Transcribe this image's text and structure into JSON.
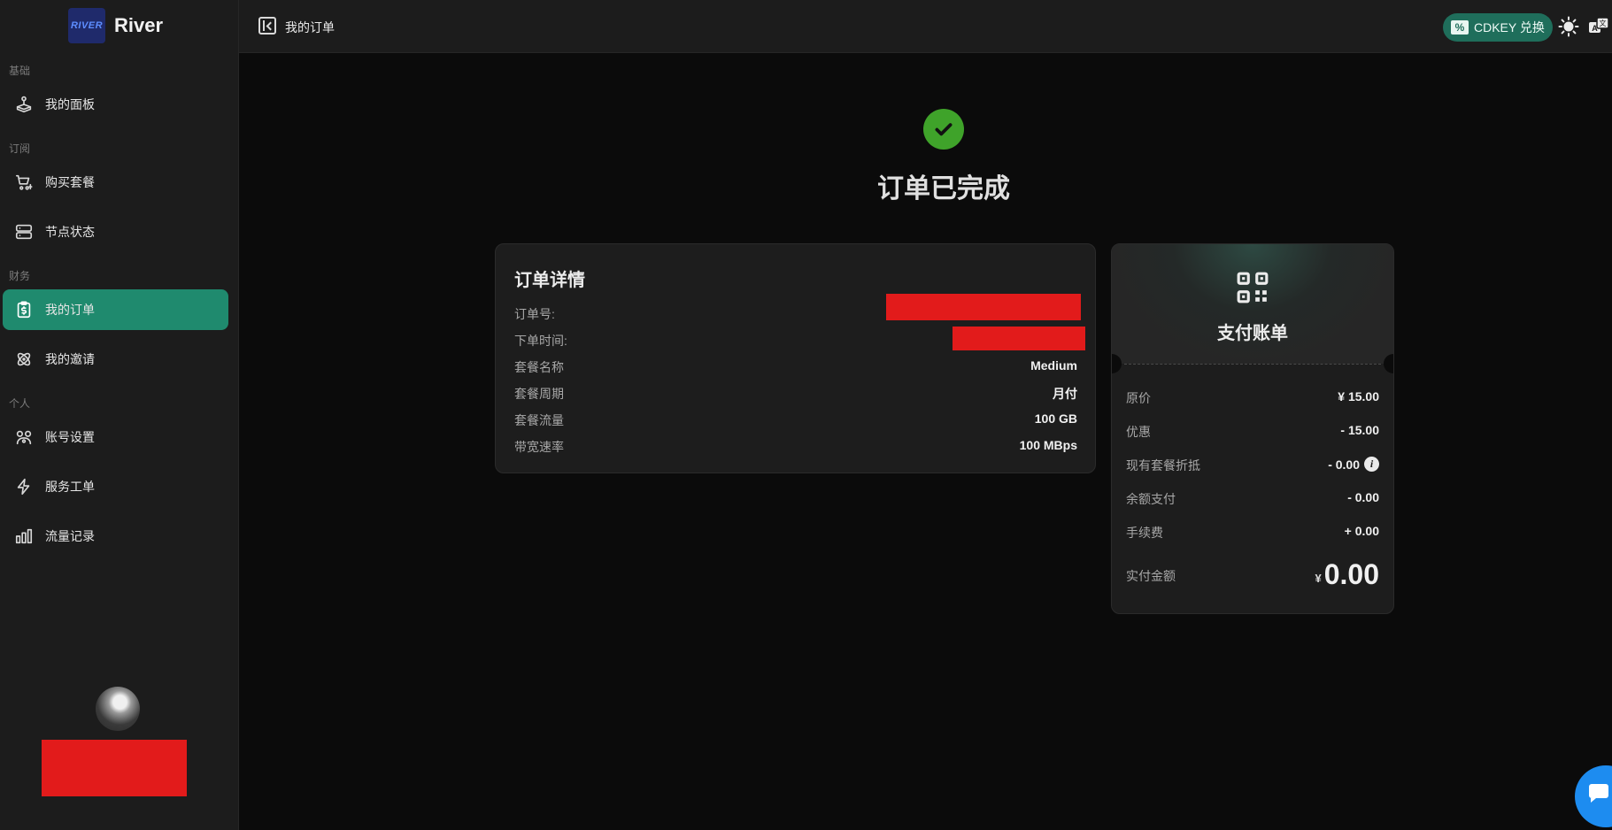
{
  "brand": {
    "logo_text": "RIVER",
    "name": "River"
  },
  "sidebar": {
    "sections": [
      {
        "label": "基础",
        "items": [
          {
            "label": "我的面板",
            "icon": "dashboard-icon"
          }
        ]
      },
      {
        "label": "订阅",
        "items": [
          {
            "label": "购买套餐",
            "icon": "cart-icon"
          },
          {
            "label": "节点状态",
            "icon": "server-icon"
          }
        ]
      },
      {
        "label": "财务",
        "items": [
          {
            "label": "我的订单",
            "icon": "clipboard-dollar-icon",
            "active": true
          },
          {
            "label": "我的邀请",
            "icon": "atom-icon"
          }
        ]
      },
      {
        "label": "个人",
        "items": [
          {
            "label": "账号设置",
            "icon": "user-settings-icon"
          },
          {
            "label": "服务工单",
            "icon": "bolt-icon"
          },
          {
            "label": "流量记录",
            "icon": "bar-chart-icon"
          }
        ]
      }
    ]
  },
  "topbar": {
    "page_title": "我的订单",
    "cdkey_label": "CDKEY 兑换",
    "colors": {
      "accent": "#1f6e5b",
      "active_nav": "#1f8a6e",
      "success": "#3fa32a"
    }
  },
  "status": {
    "title": "订单已完成"
  },
  "order_details": {
    "title": "订单详情",
    "rows": [
      {
        "label": "订单号:",
        "value": ""
      },
      {
        "label": "下单时间:",
        "value": ""
      },
      {
        "label": "套餐名称",
        "value": "Medium"
      },
      {
        "label": "套餐周期",
        "value": "月付"
      },
      {
        "label": "套餐流量",
        "value": "100 GB"
      },
      {
        "label": "带宽速率",
        "value": "100 MBps"
      }
    ]
  },
  "bill": {
    "title": "支付账单",
    "rows": [
      {
        "label": "原价",
        "value": "¥ 15.00"
      },
      {
        "label": "优惠",
        "value": "- 15.00"
      },
      {
        "label": "现有套餐折抵",
        "value": "- 0.00"
      },
      {
        "label": "余额支付",
        "value": "- 0.00"
      },
      {
        "label": "手续费",
        "value": "+ 0.00"
      }
    ],
    "total_label": "实付金额",
    "total_currency": "¥",
    "total_amount": "0.00"
  }
}
